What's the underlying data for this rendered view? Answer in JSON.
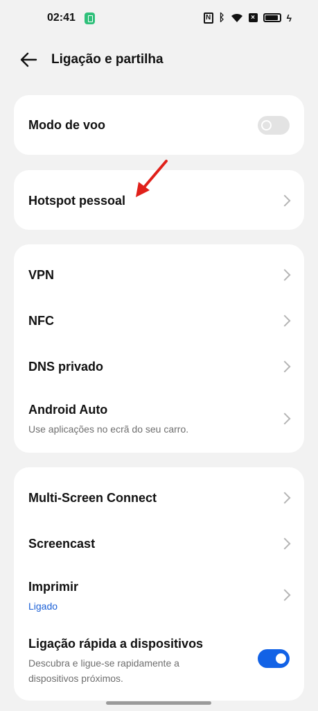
{
  "status_bar": {
    "time": "02:41",
    "icons": [
      "battery-saver-icon",
      "nfc-icon",
      "bluetooth-icon",
      "wifi-icon",
      "x-box-icon",
      "battery-icon",
      "charging-icon"
    ]
  },
  "header": {
    "title": "Ligação e partilha",
    "back_icon": "back-arrow-icon"
  },
  "cards": {
    "airplane": {
      "label": "Modo de voo",
      "toggle": "off"
    },
    "hotspot": {
      "label": "Hotspot pessoal"
    },
    "network": {
      "items": [
        {
          "label": "VPN"
        },
        {
          "label": "NFC"
        },
        {
          "label": "DNS privado"
        },
        {
          "label": "Android Auto",
          "sub": "Use aplicações no ecrã do seu carro."
        }
      ]
    },
    "connect": {
      "items": [
        {
          "label": "Multi-Screen Connect"
        },
        {
          "label": "Screencast"
        },
        {
          "label": "Imprimir",
          "sub": "Ligado"
        },
        {
          "label": "Ligação rápida a dispositivos",
          "sub": "Descubra e ligue-se rapidamente a dispositivos próximos.",
          "toggle": "on"
        }
      ]
    }
  },
  "colors": {
    "background": "#f2f2f2",
    "card": "#ffffff",
    "accent": "#1262e6",
    "annotation_arrow": "#e0201a"
  }
}
